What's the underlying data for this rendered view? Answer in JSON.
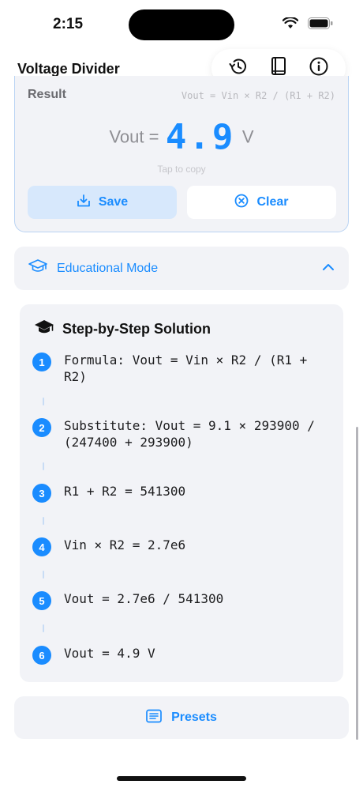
{
  "status_bar": {
    "time": "2:15"
  },
  "nav": {
    "title": "Voltage Divider"
  },
  "toolbar": {
    "icons": [
      "history-icon",
      "book-icon",
      "info-icon"
    ]
  },
  "result": {
    "title": "Result",
    "formula": "Vout = Vin × R2 / (R1 + R2)",
    "vout_label": "Vout =",
    "value": "4.9",
    "unit": "V",
    "tap_hint": "Tap to copy",
    "save_label": "Save",
    "clear_label": "Clear"
  },
  "educational": {
    "label": "Educational Mode",
    "expanded": true
  },
  "steps": {
    "title": "Step-by-Step Solution",
    "items": [
      {
        "num": "1",
        "text": "Formula: Vout = Vin × R2 / (R1 + R2)"
      },
      {
        "num": "2",
        "text": "Substitute: Vout = 9.1 × 293900 / (247400 + 293900)"
      },
      {
        "num": "3",
        "text": "R1 + R2 = 541300"
      },
      {
        "num": "4",
        "text": "Vin × R2 = 2.7e6"
      },
      {
        "num": "5",
        "text": "Vout = 2.7e6 / 541300"
      },
      {
        "num": "6",
        "text": "Vout = 4.9 V"
      }
    ]
  },
  "presets": {
    "label": "Presets"
  },
  "colors": {
    "accent": "#1a8cff",
    "card_bg": "#f2f3f7",
    "save_bg": "#d7e8fc"
  }
}
